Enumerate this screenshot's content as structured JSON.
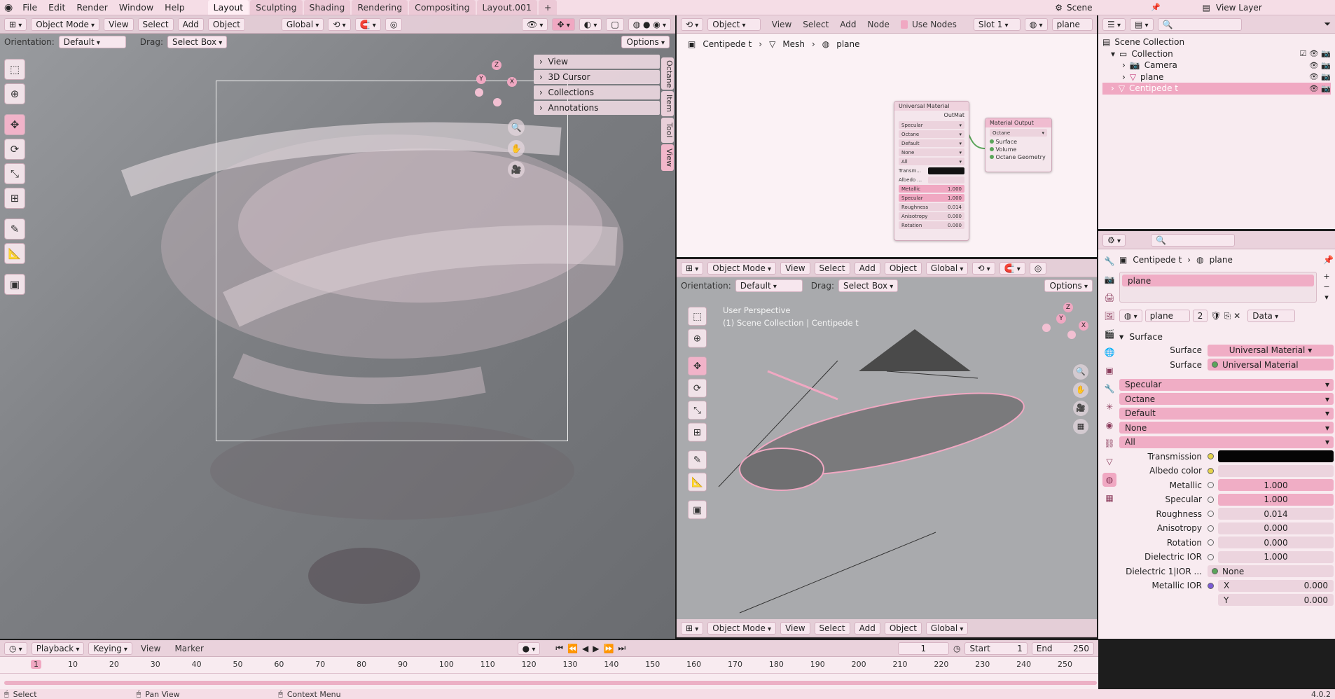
{
  "topbar": {
    "menus": [
      "File",
      "Edit",
      "Render",
      "Window",
      "Help"
    ],
    "tabs": [
      "Layout",
      "Sculpting",
      "Shading",
      "Rendering",
      "Compositing",
      "Layout.001"
    ],
    "scene": "Scene",
    "view_layer": "View Layer"
  },
  "viewport_left": {
    "mode": "Object Mode",
    "menus": [
      "View",
      "Select",
      "Add",
      "Object"
    ],
    "transform": "Global",
    "orientation_label": "Orientation:",
    "orientation_value": "Default",
    "drag_label": "Drag:",
    "drag_value": "Select Box",
    "options": "Options",
    "npanel": [
      "View",
      "3D Cursor",
      "Collections",
      "Annotations"
    ],
    "side_tabs": [
      "Octane",
      "Item",
      "Tool",
      "View"
    ],
    "gizmo": {
      "x": "X",
      "y": "Y",
      "z": "Z"
    }
  },
  "node_editor": {
    "editor": "Object",
    "menus": [
      "View",
      "Select",
      "Add",
      "Node"
    ],
    "use_nodes": "Use Nodes",
    "slot": "Slot 1",
    "material": "plane",
    "breadcrumb": [
      "Centipede t",
      "Mesh",
      "plane"
    ],
    "universal_node": {
      "title": "Universal Material",
      "output": "OutMat",
      "dropdowns": [
        "Specular",
        "Octane",
        "Default",
        "None",
        "All"
      ],
      "rows": [
        {
          "label": "Transm...",
          "value": ""
        },
        {
          "label": "Albedo ...",
          "value": ""
        },
        {
          "label": "Metallic",
          "value": "1.000"
        },
        {
          "label": "Specular",
          "value": "1.000"
        },
        {
          "label": "Roughness",
          "value": "0.014"
        },
        {
          "label": "Anisotropy",
          "value": "0.000"
        },
        {
          "label": "Rotation",
          "value": "0.000"
        }
      ]
    },
    "output_node": {
      "title": "Material Output",
      "target": "Octane",
      "inputs": [
        "Surface",
        "Volume",
        "Octane Geometry"
      ]
    }
  },
  "viewport_right": {
    "mode": "Object Mode",
    "menus": [
      "View",
      "Select",
      "Add",
      "Object"
    ],
    "transform": "Global",
    "orientation_label": "Orientation:",
    "orientation_value": "Default",
    "drag_label": "Drag:",
    "drag_value": "Select Box",
    "options": "Options",
    "info_line1": "User Perspective",
    "info_line2": "(1) Scene Collection | Centipede t",
    "gizmo": {
      "x": "X",
      "y": "Y",
      "z": "Z"
    }
  },
  "outliner": {
    "items": [
      {
        "label": "Scene Collection",
        "indent": 0
      },
      {
        "label": "Collection",
        "indent": 1
      },
      {
        "label": "Camera",
        "indent": 2
      },
      {
        "label": "plane",
        "indent": 2
      },
      {
        "label": "Centipede t",
        "indent": 1
      }
    ]
  },
  "properties": {
    "breadcrumb_obj": "Centipede t",
    "breadcrumb_mat": "plane",
    "slot_name": "plane",
    "mat_name": "plane",
    "users": "2",
    "link": "Data",
    "panel": "Surface",
    "surface_label": "Surface",
    "surface_shader": "Universal Material",
    "surface_label2": "Surface",
    "surface_link": "Universal Material",
    "dropdowns": [
      "Specular",
      "Octane",
      "Default",
      "None",
      "All"
    ],
    "fields": [
      {
        "label": "Transmission",
        "value": "",
        "kind": "color-black"
      },
      {
        "label": "Albedo color",
        "value": "",
        "kind": "color"
      },
      {
        "label": "Metallic",
        "value": "1.000",
        "kind": "pink"
      },
      {
        "label": "Specular",
        "value": "1.000",
        "kind": "pink"
      },
      {
        "label": "Roughness",
        "value": "0.014",
        "kind": "plain"
      },
      {
        "label": "Anisotropy",
        "value": "0.000",
        "kind": "plain"
      },
      {
        "label": "Rotation",
        "value": "0.000",
        "kind": "plain"
      },
      {
        "label": "Dielectric IOR",
        "value": "1.000",
        "kind": "plain"
      },
      {
        "label": "Dielectric 1|IOR ...",
        "value": "None",
        "kind": "link"
      }
    ],
    "metallic_ior_label": "Metallic IOR",
    "ior_x_label": "X",
    "ior_x": "0.000",
    "ior_y_label": "Y",
    "ior_y": "0.000"
  },
  "timeline": {
    "menus": [
      "Playback",
      "Keying",
      "View",
      "Marker"
    ],
    "current_frame": "1",
    "start_label": "Start",
    "start": "1",
    "end_label": "End",
    "end": "250",
    "ticks": [
      "1",
      "10",
      "20",
      "30",
      "40",
      "50",
      "60",
      "70",
      "80",
      "90",
      "100",
      "110",
      "120",
      "130",
      "140",
      "150",
      "160",
      "170",
      "180",
      "190",
      "200",
      "210",
      "220",
      "230",
      "240",
      "250"
    ]
  },
  "statusbar": {
    "select": "Select",
    "pan": "Pan View",
    "context": "Context Menu",
    "version": "4.0.2"
  },
  "colors": {
    "accent": "#f0a8c2",
    "header": "#ead2dc",
    "panel": "#f7e8ee"
  }
}
